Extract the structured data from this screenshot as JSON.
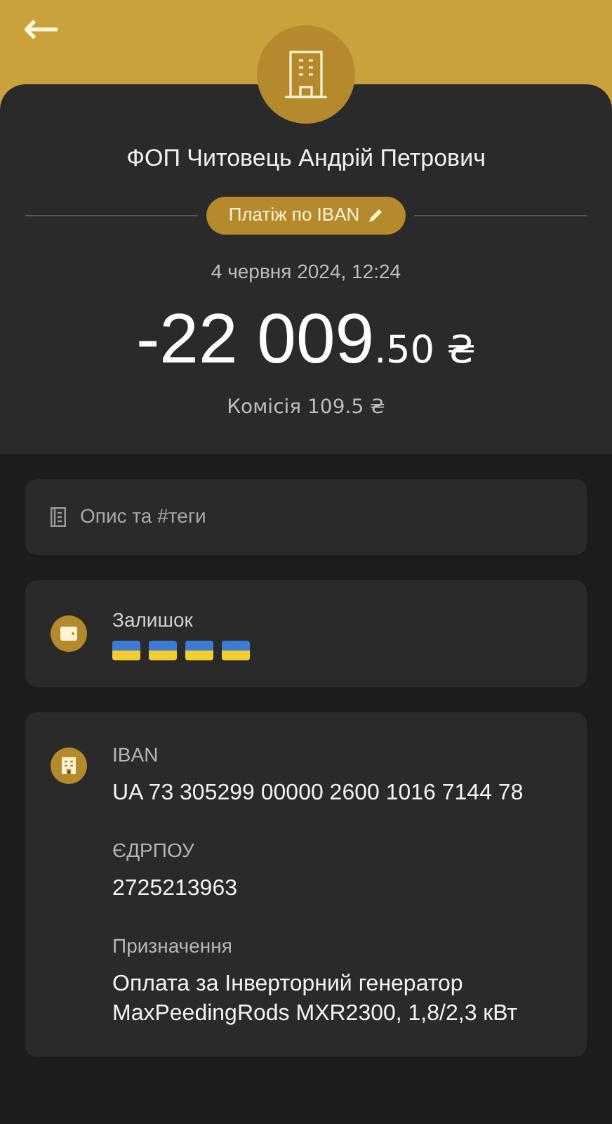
{
  "header": {
    "back": "←"
  },
  "payee": {
    "name": "ФОП Читовець Андрій Петрович",
    "category": "Платіж по IBAN",
    "date": "4 червня 2024, 12:24",
    "amount_main": "-22 009",
    "amount_cents": ".50 ₴",
    "commission": "Комісія 109.5 ₴"
  },
  "description": {
    "placeholder": "Опис та #теги"
  },
  "balance": {
    "label": "Залишок",
    "marks": [
      {
        "kind": "flag"
      },
      {
        "kind": "flag"
      },
      {
        "kind": "flag"
      },
      {
        "kind": "flag"
      }
    ]
  },
  "details": [
    {
      "label": "IBAN",
      "value": "UA 73 305299 00000 2600 1016 7144 78"
    },
    {
      "label": "ЄДРПОУ",
      "value": "2725213963"
    },
    {
      "label": "Призначення",
      "value": "Оплата за Інверторний генератор MaxPeedingRods MXR2300, 1,8/2,3 кВт"
    }
  ]
}
